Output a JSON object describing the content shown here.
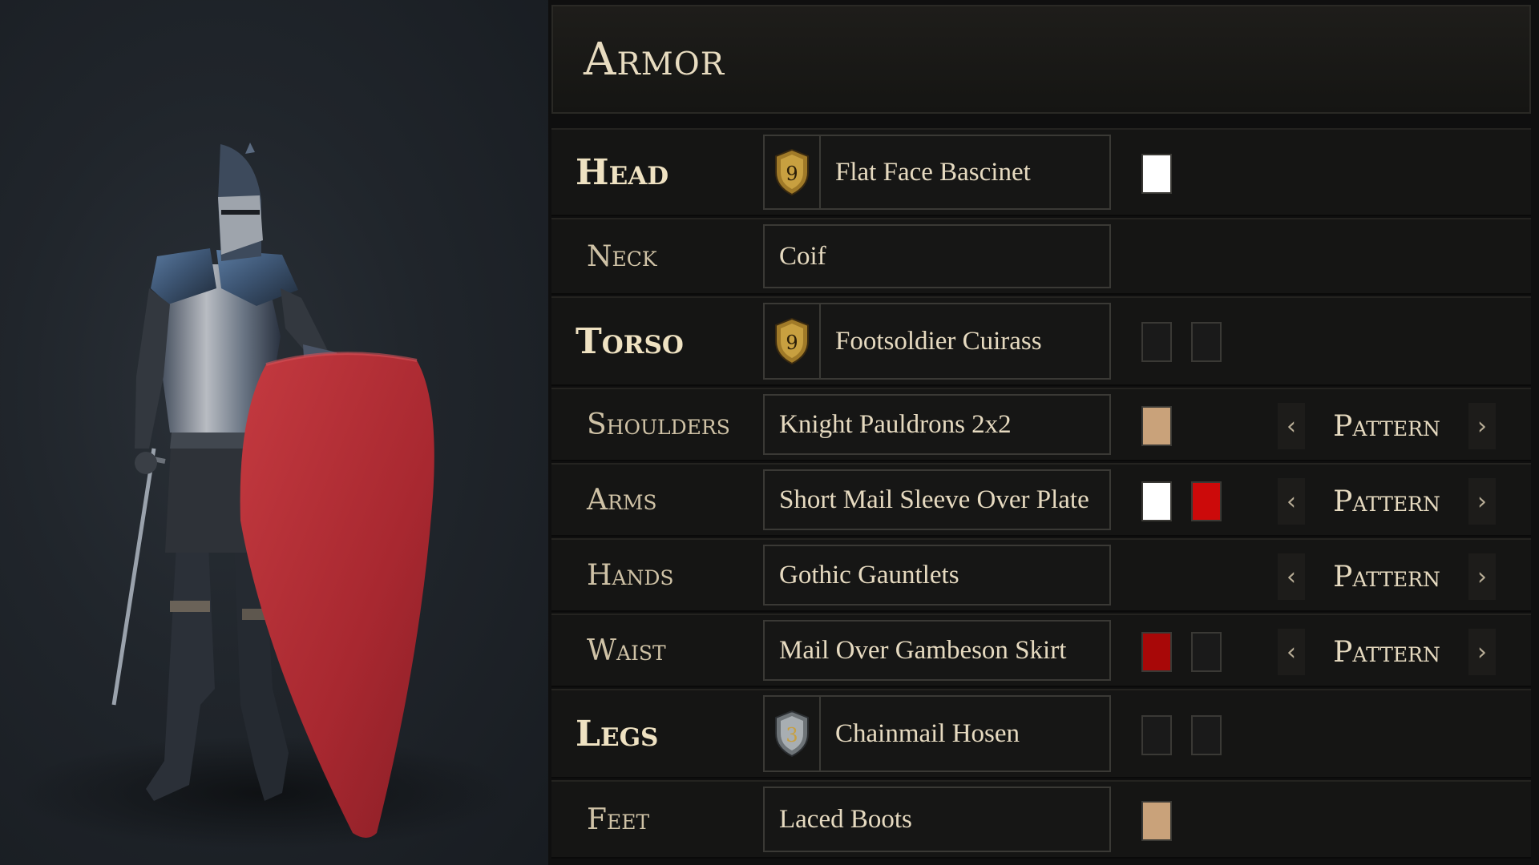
{
  "panel": {
    "title": "Armor"
  },
  "slots": {
    "head": {
      "label": "Head",
      "item": "Flat Face Bascinet",
      "tier": "9",
      "tier_style": "gold",
      "colors": [
        "#ffffff"
      ]
    },
    "neck": {
      "label": "Neck",
      "item": "Coif",
      "colors": []
    },
    "torso": {
      "label": "Torso",
      "item": "Footsoldier Cuirass",
      "tier": "9",
      "tier_style": "gold",
      "colors": [
        "#1a1a1a",
        "#1a1a1a"
      ]
    },
    "shoulders": {
      "label": "Shoulders",
      "item": "Knight Pauldrons 2x2",
      "colors": [
        "#c9a27a"
      ],
      "pattern_label": "Pattern"
    },
    "arms": {
      "label": "Arms",
      "item": "Short Mail Sleeve Over Plate",
      "colors": [
        "#ffffff",
        "#cc0a0a"
      ],
      "pattern_label": "Pattern"
    },
    "hands": {
      "label": "Hands",
      "item": "Gothic Gauntlets",
      "colors": [],
      "pattern_label": "Pattern"
    },
    "waist": {
      "label": "Waist",
      "item": "Mail Over Gambeson Skirt",
      "colors": [
        "#a80808",
        "#1a1a1a"
      ],
      "pattern_label": "Pattern"
    },
    "legs": {
      "label": "Legs",
      "item": "Chainmail Hosen",
      "tier": "3",
      "tier_style": "silver",
      "colors": [
        "#1a1a1a",
        "#1a1a1a"
      ]
    },
    "feet": {
      "label": "Feet",
      "item": "Laced Boots",
      "colors": [
        "#c9a27a"
      ]
    }
  },
  "icons": {
    "prev": "chevron-left-icon",
    "next": "chevron-right-icon",
    "tier": "shield-tier-icon"
  },
  "theme": {
    "text": "#e6dac0",
    "gold": "#c8a040",
    "silver": "#9aa0a4",
    "shield_red": "#b22a30"
  }
}
